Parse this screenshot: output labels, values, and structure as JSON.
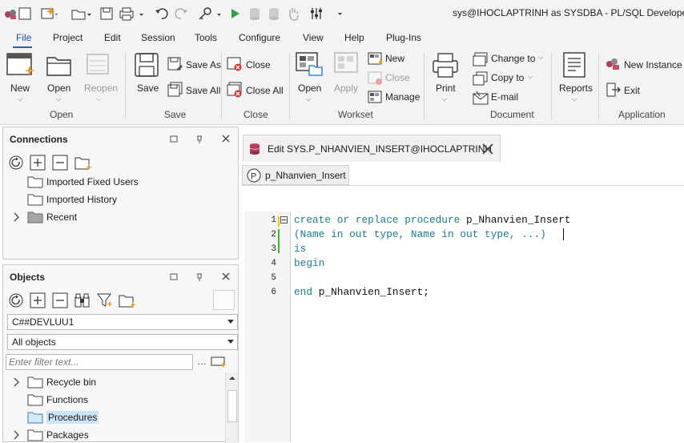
{
  "window": {
    "title": "sys@IHOCLAPTRINH as SYSDBA - PL/SQL Developer -"
  },
  "menu": [
    "File",
    "Project",
    "Edit",
    "Session",
    "Tools",
    "Configure",
    "View",
    "Help",
    "Plug-Ins"
  ],
  "ribbon": {
    "open_group": {
      "new": "New",
      "open": "Open",
      "reopen": "Reopen",
      "label": "Open"
    },
    "save_group": {
      "save": "Save",
      "save_as": "Save As",
      "save_all": "Save All",
      "label": "Save"
    },
    "close_group": {
      "close": "Close",
      "close_all": "Close All",
      "label": "Close"
    },
    "workset_group": {
      "open": "Open",
      "apply": "Apply",
      "new": "New",
      "close": "Close",
      "manage": "Manage",
      "label": "Workset"
    },
    "document_group": {
      "print": "Print",
      "change_to": "Change to",
      "copy_to": "Copy to",
      "email": "E-mail",
      "label": "Document"
    },
    "reports_group": {
      "reports": "Reports"
    },
    "application_group": {
      "new_instance": "New Instance",
      "exit": "Exit",
      "label": "Application"
    }
  },
  "connections": {
    "title": "Connections",
    "items": [
      "Imported Fixed Users",
      "Imported History",
      "Recent"
    ]
  },
  "objects": {
    "title": "Objects",
    "user": "C##DEVLUU1",
    "filter": "All objects",
    "filter_placeholder": "Enter filter text...",
    "items": [
      "Recycle bin",
      "Functions",
      "Procedures",
      "Packages"
    ]
  },
  "editor": {
    "tab_title": "Edit SYS.P_NHANVIEN_INSERT@IHOCLAPTRINH",
    "subtab": "p_Nhanvien_Insert",
    "line_numbers": [
      "1",
      "2",
      "3",
      "4",
      "5",
      "6"
    ],
    "code": {
      "l1_kw": "create or replace procedure",
      "l1_id": "p_Nhanvien_Insert",
      "l2": "(Name in out type, Name in out type, ...)",
      "l3": "is",
      "l4": "begin",
      "l6_kw": "end",
      "l6_id": "p_Nhanvien_Insert;"
    }
  },
  "colors": {
    "keyword": "#1f7a8c",
    "selection": "#cce4f7",
    "accent": "#1a5fb4"
  }
}
